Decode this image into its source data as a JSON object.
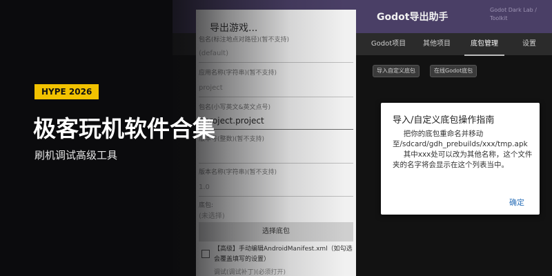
{
  "app": {
    "title": "Godot导出助手",
    "subtitle": "Godot Dark Lab / Toolkit",
    "tabs": [
      "Godot项目",
      "其他项目",
      "底包管理",
      "设置"
    ],
    "active_tab": "底包管理",
    "actions": [
      "导入自定义底包",
      "在线Godot底包"
    ]
  },
  "export_dialog": {
    "title": "导出游戏...",
    "fields": [
      {
        "label": "包名(标注地点对路径)(暂不支持)",
        "value": "(default)"
      },
      {
        "label": "应用名称(字符串)(暂不支持)",
        "value": "project"
      },
      {
        "label": "包名(小写英文&英文点号)",
        "value": "hproject.project"
      },
      {
        "label": "版本号(整数)(暂不支持)",
        "value": ""
      },
      {
        "label": "版本名称(字符串)(暂不支持)",
        "value": "1.0"
      },
      {
        "label": "底包:",
        "value": "(未选择)"
      }
    ],
    "select_button": "选择底包",
    "checkbox_label": "【高级】手动编辑AndroidManifest.xml（如勾选会覆盖填写的设置）",
    "cutoff_text": "调试(调试补丁)(必须打开)"
  },
  "promo": {
    "badge": "HYPE 2026",
    "headline": "极客玩机软件合集",
    "subline": "刷机调试高级工具"
  },
  "guide_dialog": {
    "title": "导入/自定义底包操作指南",
    "paragraph1": "把你的底包重命名并移动至/sdcard/gdh_prebuilds/xxx/tmp.apk",
    "paragraph2": "其中xxx处可以改为其他名称，这个文件夹的名字将会显示在这个列表当中。",
    "ok_label": "确定"
  },
  "colors": {
    "header": "#4a3f66",
    "badge": "#f2c200",
    "link": "#2a6fb8"
  }
}
